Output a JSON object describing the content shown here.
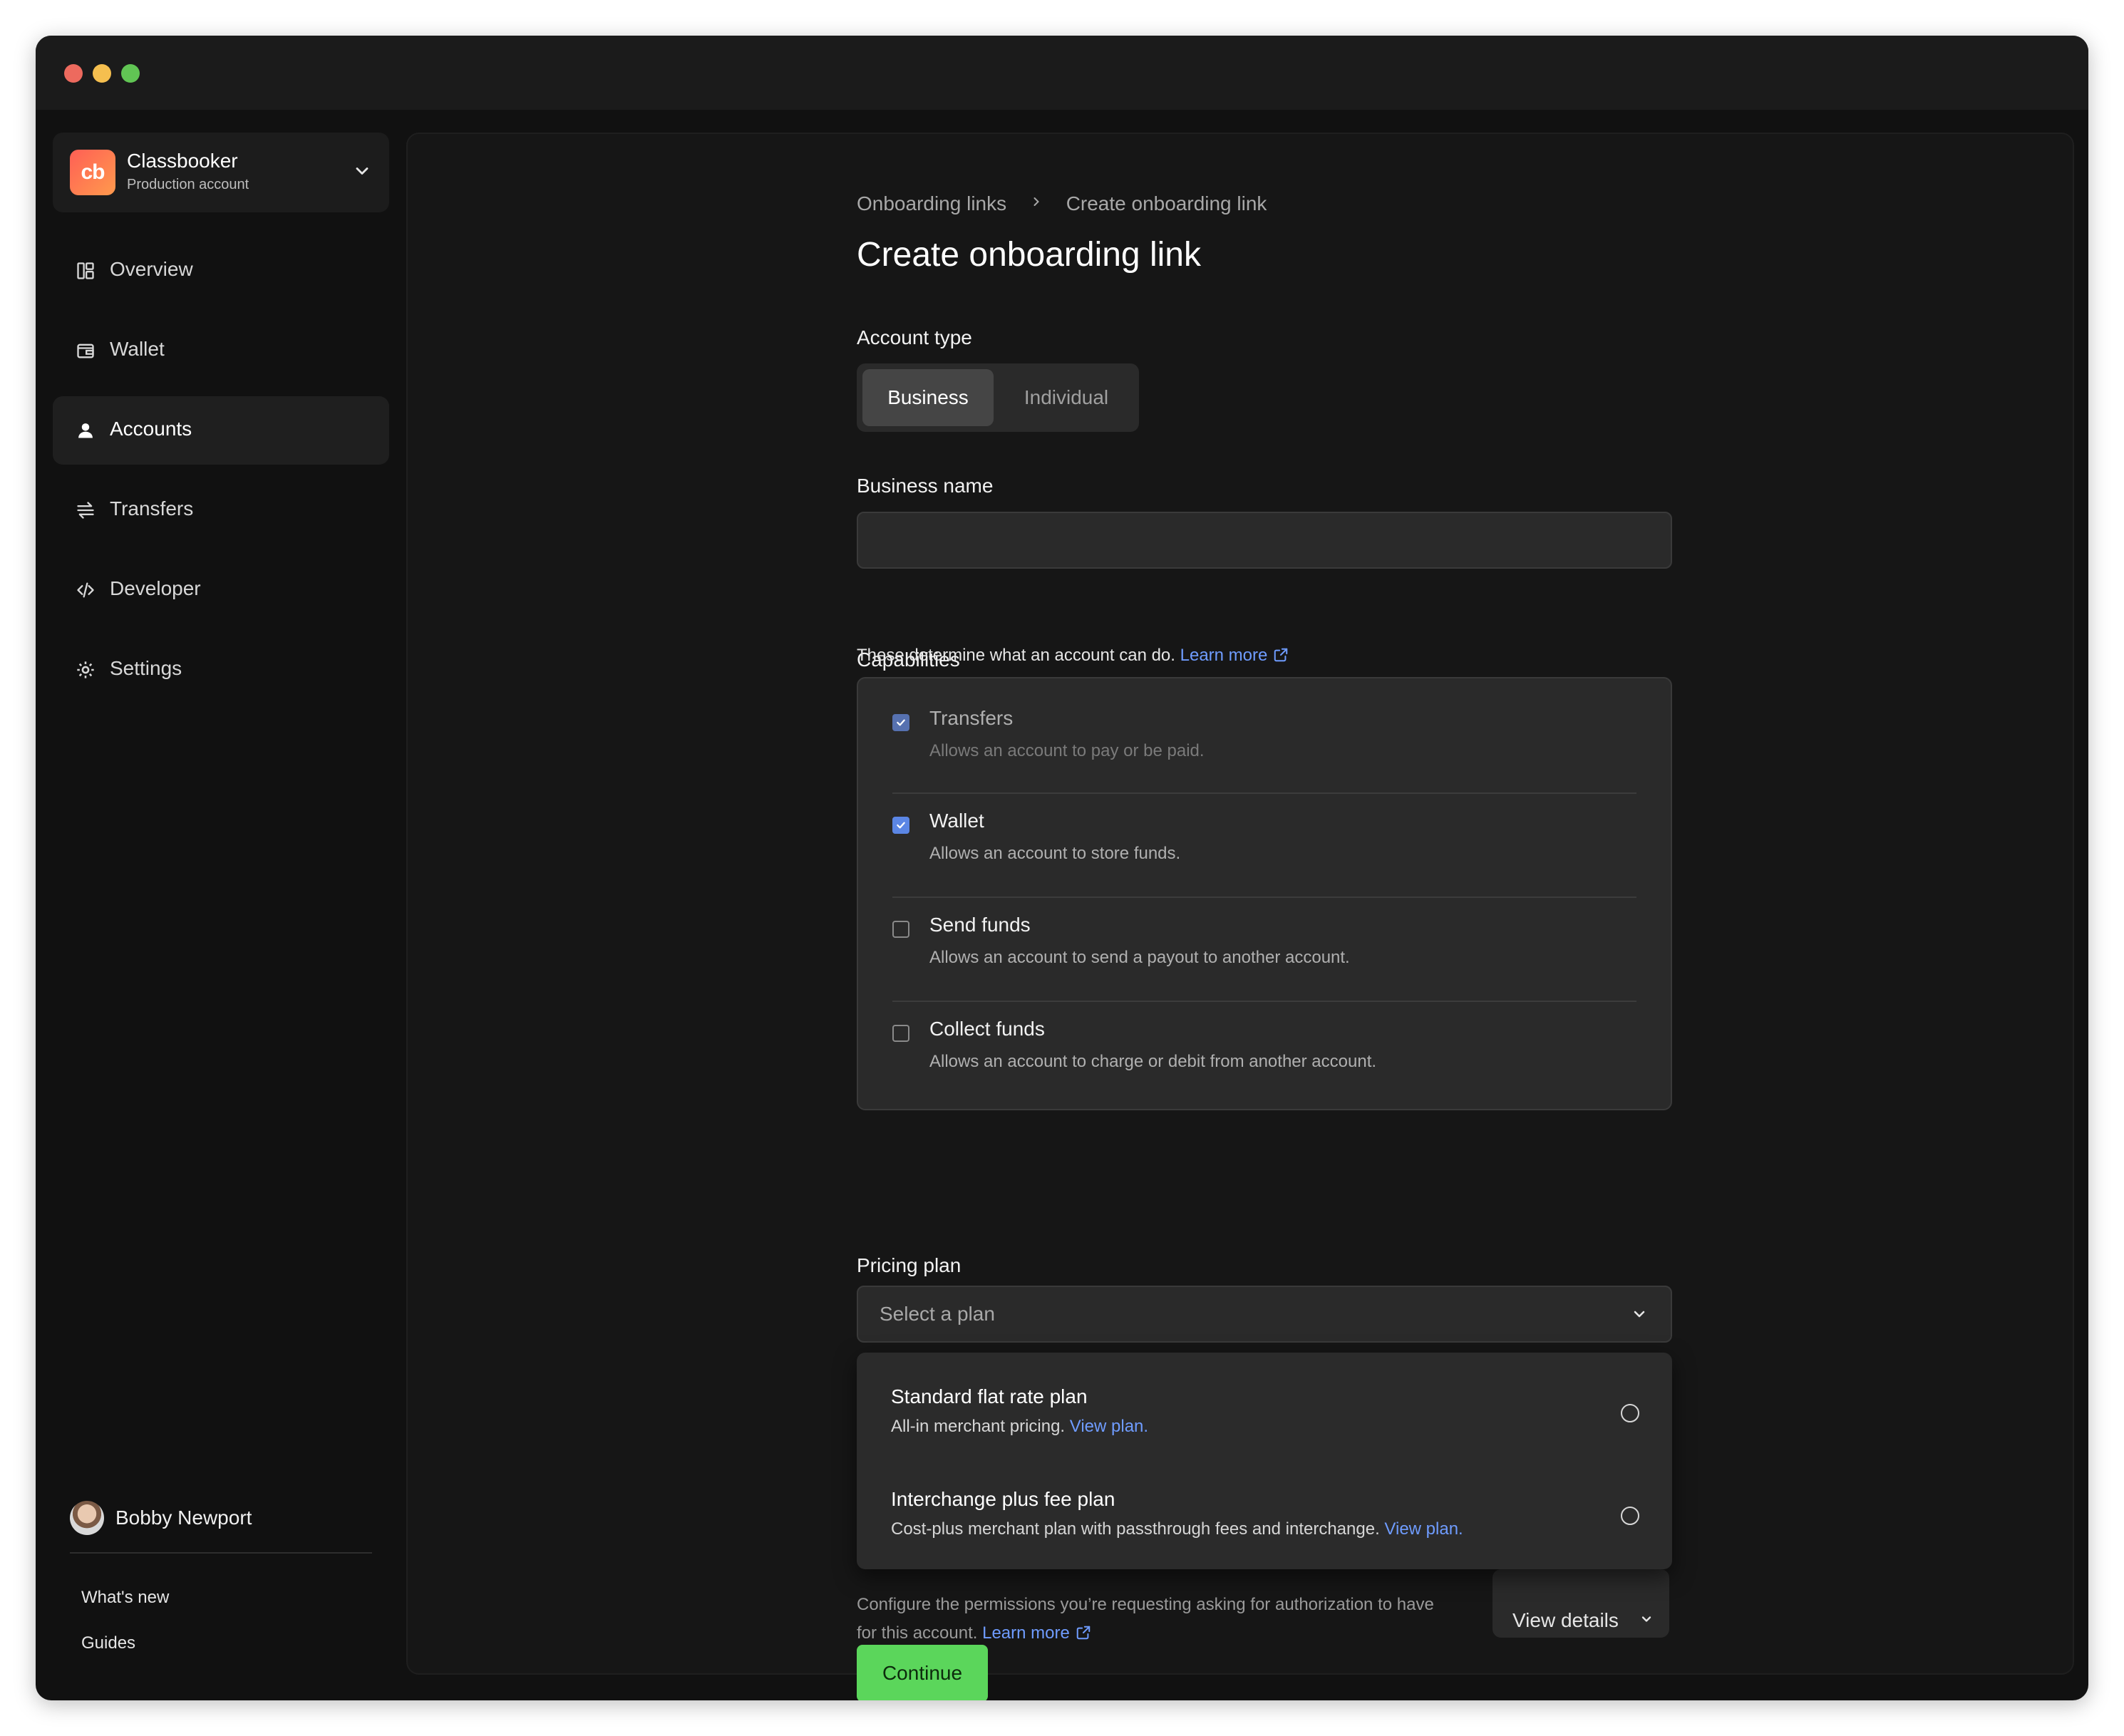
{
  "org": {
    "logo_text": "cb",
    "name": "Classbooker",
    "subtitle": "Production account"
  },
  "sidebar": {
    "items": [
      {
        "label": "Overview",
        "icon": "overview-icon",
        "active": false
      },
      {
        "label": "Wallet",
        "icon": "wallet-icon",
        "active": false
      },
      {
        "label": "Accounts",
        "icon": "user-icon",
        "active": true
      },
      {
        "label": "Transfers",
        "icon": "transfers-icon",
        "active": false
      },
      {
        "label": "Developer",
        "icon": "code-icon",
        "active": false
      },
      {
        "label": "Settings",
        "icon": "gear-icon",
        "active": false
      }
    ],
    "user": {
      "name": "Bobby Newport"
    },
    "footer_links": [
      "What's new",
      "Guides"
    ]
  },
  "breadcrumb": [
    "Onboarding links",
    "Create onboarding link"
  ],
  "page_title": "Create onboarding link",
  "account_type": {
    "label": "Account type",
    "options": [
      "Business",
      "Individual"
    ],
    "selected": "Business"
  },
  "business_name": {
    "label": "Business name",
    "value": ""
  },
  "capabilities": {
    "label": "Capabilities",
    "description": "These determine what an account can do.",
    "learn_more": "Learn more",
    "items": [
      {
        "title": "Transfers",
        "description": "Allows an account to pay or be paid.",
        "checked": true,
        "disabled": true
      },
      {
        "title": "Wallet",
        "description": "Allows an account to store funds.",
        "checked": true,
        "disabled": false
      },
      {
        "title": "Send funds",
        "description": "Allows an account to send a payout to another account.",
        "checked": false,
        "disabled": false
      },
      {
        "title": "Collect funds",
        "description": "Allows an account to charge or debit from another account.",
        "checked": false,
        "disabled": false
      }
    ]
  },
  "pricing_plan": {
    "label": "Pricing plan",
    "placeholder": "Select a plan",
    "options": [
      {
        "title": "Standard flat rate plan",
        "description": "All-in merchant pricing.",
        "link": "View plan."
      },
      {
        "title": "Interchange plus fee plan",
        "description": "Cost-plus merchant plan with passthrough fees and interchange.",
        "link": "View plan."
      }
    ]
  },
  "permissions": {
    "text": "Configure the permissions you’re requesting asking for authorization to have for this account.",
    "learn_more": "Learn more",
    "view_details": "View details"
  },
  "continue_label": "Continue",
  "colors": {
    "accent_green": "#5bd65b",
    "link_blue": "#6f9cff",
    "checkbox_blue": "#5b86e5"
  }
}
